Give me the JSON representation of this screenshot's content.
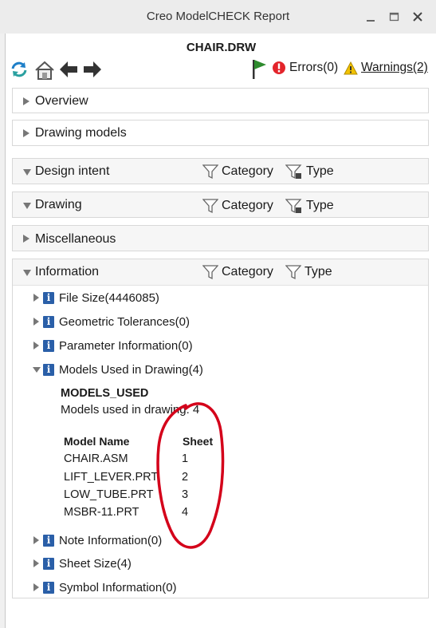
{
  "window": {
    "title": "Creo ModelCHECK Report",
    "colors": {
      "titlebar": "#ececec",
      "flag": "#2e8b2e",
      "error": "#e3242b",
      "warning": "#f2c200",
      "info": "#2a5fa8",
      "annotation": "#d4001a"
    }
  },
  "toolbar": {
    "icons": [
      "refresh-icon",
      "home-icon",
      "back-arrow-icon",
      "forward-arrow-icon"
    ],
    "status_icons": [
      "flag-icon",
      "error-icon",
      "warning-icon"
    ]
  },
  "report": {
    "filename": "CHAIR.DRW",
    "errors_label": "Errors(0)",
    "warnings_label": "Warnings(2)"
  },
  "sections": {
    "overview": "Overview",
    "drawing_models": "Drawing models",
    "design_intent": "Design intent",
    "drawing": "Drawing",
    "miscellaneous": "Miscellaneous",
    "information": "Information"
  },
  "filters": {
    "category": "Category",
    "type": "Type"
  },
  "info_items": {
    "file_size": "File Size(4446085)",
    "geometric_tolerances": "Geometric Tolerances(0)",
    "parameter_information": "Parameter Information(0)",
    "models_used": "Models Used in Drawing(4)",
    "note_information": "Note Information(0)",
    "sheet_size": "Sheet Size(4)",
    "symbol_information": "Symbol Information(0)"
  },
  "models_used": {
    "title": "MODELS_USED",
    "description": "Models used in drawing: 4",
    "headers": [
      "Model Name",
      "Sheet"
    ],
    "rows": [
      [
        "CHAIR.ASM",
        "1"
      ],
      [
        "LIFT_LEVER.PRT",
        "2"
      ],
      [
        "LOW_TUBE.PRT",
        "3"
      ],
      [
        "MSBR-11.PRT",
        "4"
      ]
    ]
  }
}
